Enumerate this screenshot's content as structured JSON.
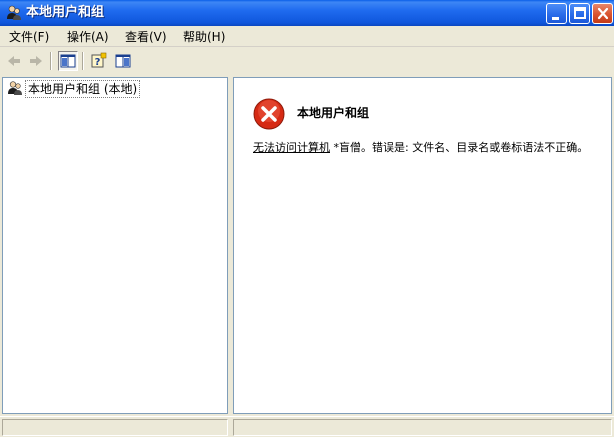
{
  "window": {
    "title": "本地用户和组",
    "icon": "users-groups-icon",
    "colors": {
      "titlebar": "#0A5FE8",
      "close": "#D9532F",
      "chrome": "#ECE9D8"
    }
  },
  "menu": {
    "items": [
      {
        "label": "文件(F)",
        "name": "menu-file"
      },
      {
        "label": "操作(A)",
        "name": "menu-action"
      },
      {
        "label": "查看(V)",
        "name": "menu-view"
      },
      {
        "label": "帮助(H)",
        "name": "menu-help"
      }
    ]
  },
  "toolbar": {
    "buttons": [
      "back-arrow-icon",
      "forward-arrow-icon",
      "show-hide-tree-icon",
      "help-icon",
      "action-pane-icon"
    ]
  },
  "tree": {
    "root_label": "本地用户和组 (本地)"
  },
  "error": {
    "title": "本地用户和组",
    "message_prefix": "无法访问计算机",
    "message_rest": " *盲僧。错误是: 文件名、目录名或卷标语法不正确。",
    "icon": "error-icon"
  }
}
